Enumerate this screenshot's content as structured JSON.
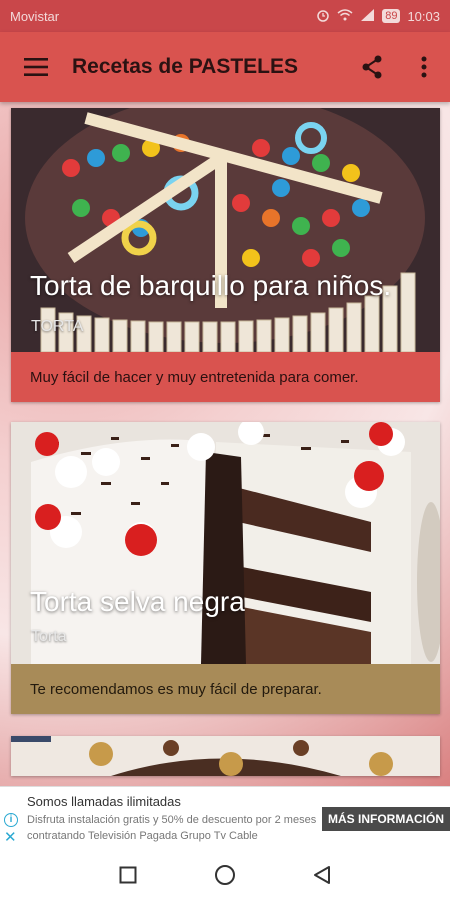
{
  "status_bar": {
    "carrier": "Movistar",
    "battery": "89",
    "time": "10:03"
  },
  "app_bar": {
    "title": "Recetas de PASTELES"
  },
  "cards": [
    {
      "title": "Torta de barquillo para niños.",
      "category": "TORTA",
      "description": "Muy fácil de hacer y muy entretenida para comer."
    },
    {
      "title": "Torta selva negra",
      "category": "Torta",
      "description": "Te recomendamos es muy fácil de preparar."
    }
  ],
  "ad": {
    "title": "Somos llamadas ilimitadas",
    "text": "Disfruta instalación gratis y 50% de descuento por 2 meses contratando Televisión Pagada Grupo Tv Cable",
    "cta": "MÁS INFORMACIÓN"
  },
  "colors": {
    "primary": "#d9534f",
    "status_bar": "#c9474a",
    "card2_footer": "#a88b58",
    "ad_accent": "#2aa9d2"
  },
  "icons": [
    "menu-icon",
    "share-icon",
    "more-vert-icon",
    "alarm-icon",
    "wifi-icon",
    "signal-icon",
    "info-icon",
    "close-icon",
    "square-icon",
    "circle-icon",
    "triangle-icon"
  ]
}
